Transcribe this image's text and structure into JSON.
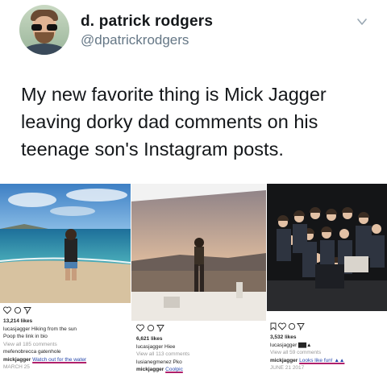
{
  "tweet": {
    "author_name": "d. patrick rodgers",
    "author_handle": "@dpatrickrodgers",
    "text": "My new favorite thing is Mick Jagger leaving dorky dad comments on his teenage son's Instagram posts."
  },
  "posts": [
    {
      "likes": "13,214 likes",
      "caption_lines": [
        "lucasjagger Hiking from the sun",
        "Poop the link in bio"
      ],
      "view_comments": "View all 185 comments",
      "comment": "mefenobrecca gatenhole",
      "highlight_user": "mickjagger",
      "highlight_text": "Watch out for the water",
      "time": "MARCH 25"
    },
    {
      "likes": "6,621 likes",
      "caption_lines": [
        "lucasjagger Hiee"
      ],
      "view_comments": "View all 113 comments",
      "comment": "lusianegmenez Pko",
      "highlight_user": "mickjagger",
      "highlight_text": "Coolpic",
      "time": ""
    },
    {
      "likes": "3,532 likes",
      "caption_lines": [
        "lucasjagger ▇▇▲"
      ],
      "view_comments": "View all 59 comments",
      "comment": "",
      "highlight_user": "mickjagger",
      "highlight_text": "Looks like fun! ▲▲",
      "time": "JUNE 21 2017"
    }
  ],
  "colors": {
    "handle": "#657786",
    "text": "#14171a",
    "link": "#2244aa",
    "underline": "#b0206a"
  },
  "icons": [
    "chevron-down-icon",
    "heart-icon",
    "comment-icon",
    "share-icon",
    "bookmark-icon"
  ]
}
